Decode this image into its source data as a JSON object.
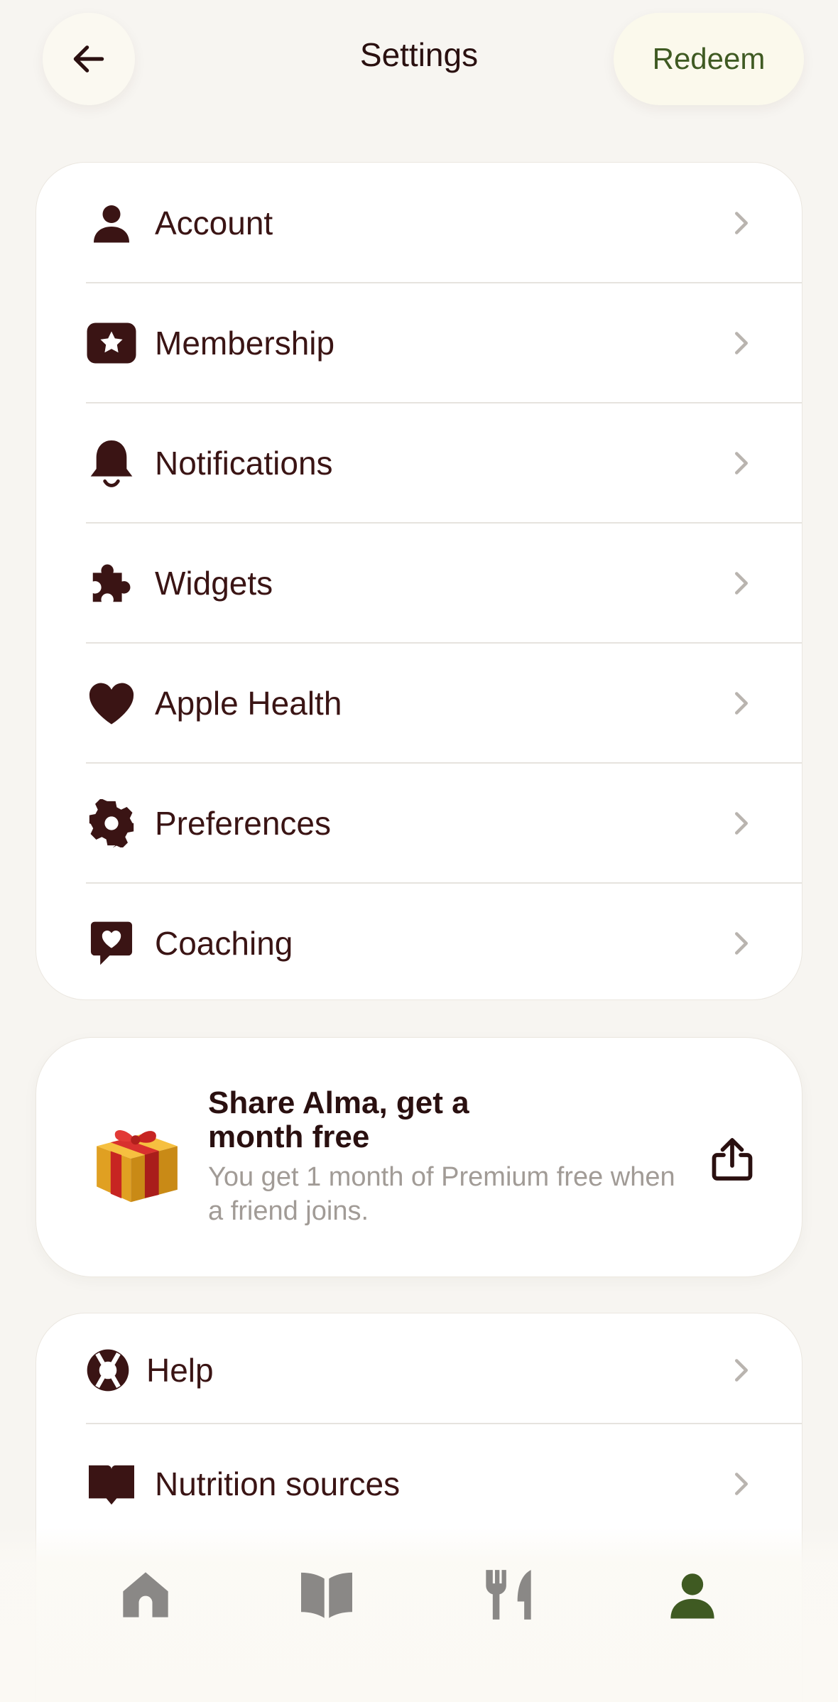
{
  "header": {
    "title": "Settings",
    "redeem_label": "Redeem"
  },
  "settings": {
    "items": [
      {
        "label": "Account",
        "icon": "person-icon"
      },
      {
        "label": "Membership",
        "icon": "star-badge-icon"
      },
      {
        "label": "Notifications",
        "icon": "bell-icon"
      },
      {
        "label": "Widgets",
        "icon": "puzzle-icon"
      },
      {
        "label": "Apple Health",
        "icon": "heart-icon"
      },
      {
        "label": "Preferences",
        "icon": "gear-icon"
      },
      {
        "label": "Coaching",
        "icon": "heart-chat-icon"
      }
    ]
  },
  "share": {
    "title": "Share Alma, get a month free",
    "description": "You get 1 month of Premium free when a friend joins."
  },
  "support": {
    "items": [
      {
        "label": "Help",
        "icon": "lifebuoy-icon"
      },
      {
        "label": "Nutrition sources",
        "icon": "book-icon"
      }
    ]
  },
  "colors": {
    "background": "#f7f5f1",
    "text": "#3a1414",
    "accent_green": "#3f5a22",
    "muted": "#a19b96"
  },
  "tabbar": {
    "tabs": [
      {
        "name": "home",
        "icon": "home-icon",
        "active": false
      },
      {
        "name": "learn",
        "icon": "open-book-icon",
        "active": false
      },
      {
        "name": "food",
        "icon": "fork-knife-icon",
        "active": false
      },
      {
        "name": "profile",
        "icon": "person-icon",
        "active": true
      }
    ]
  }
}
